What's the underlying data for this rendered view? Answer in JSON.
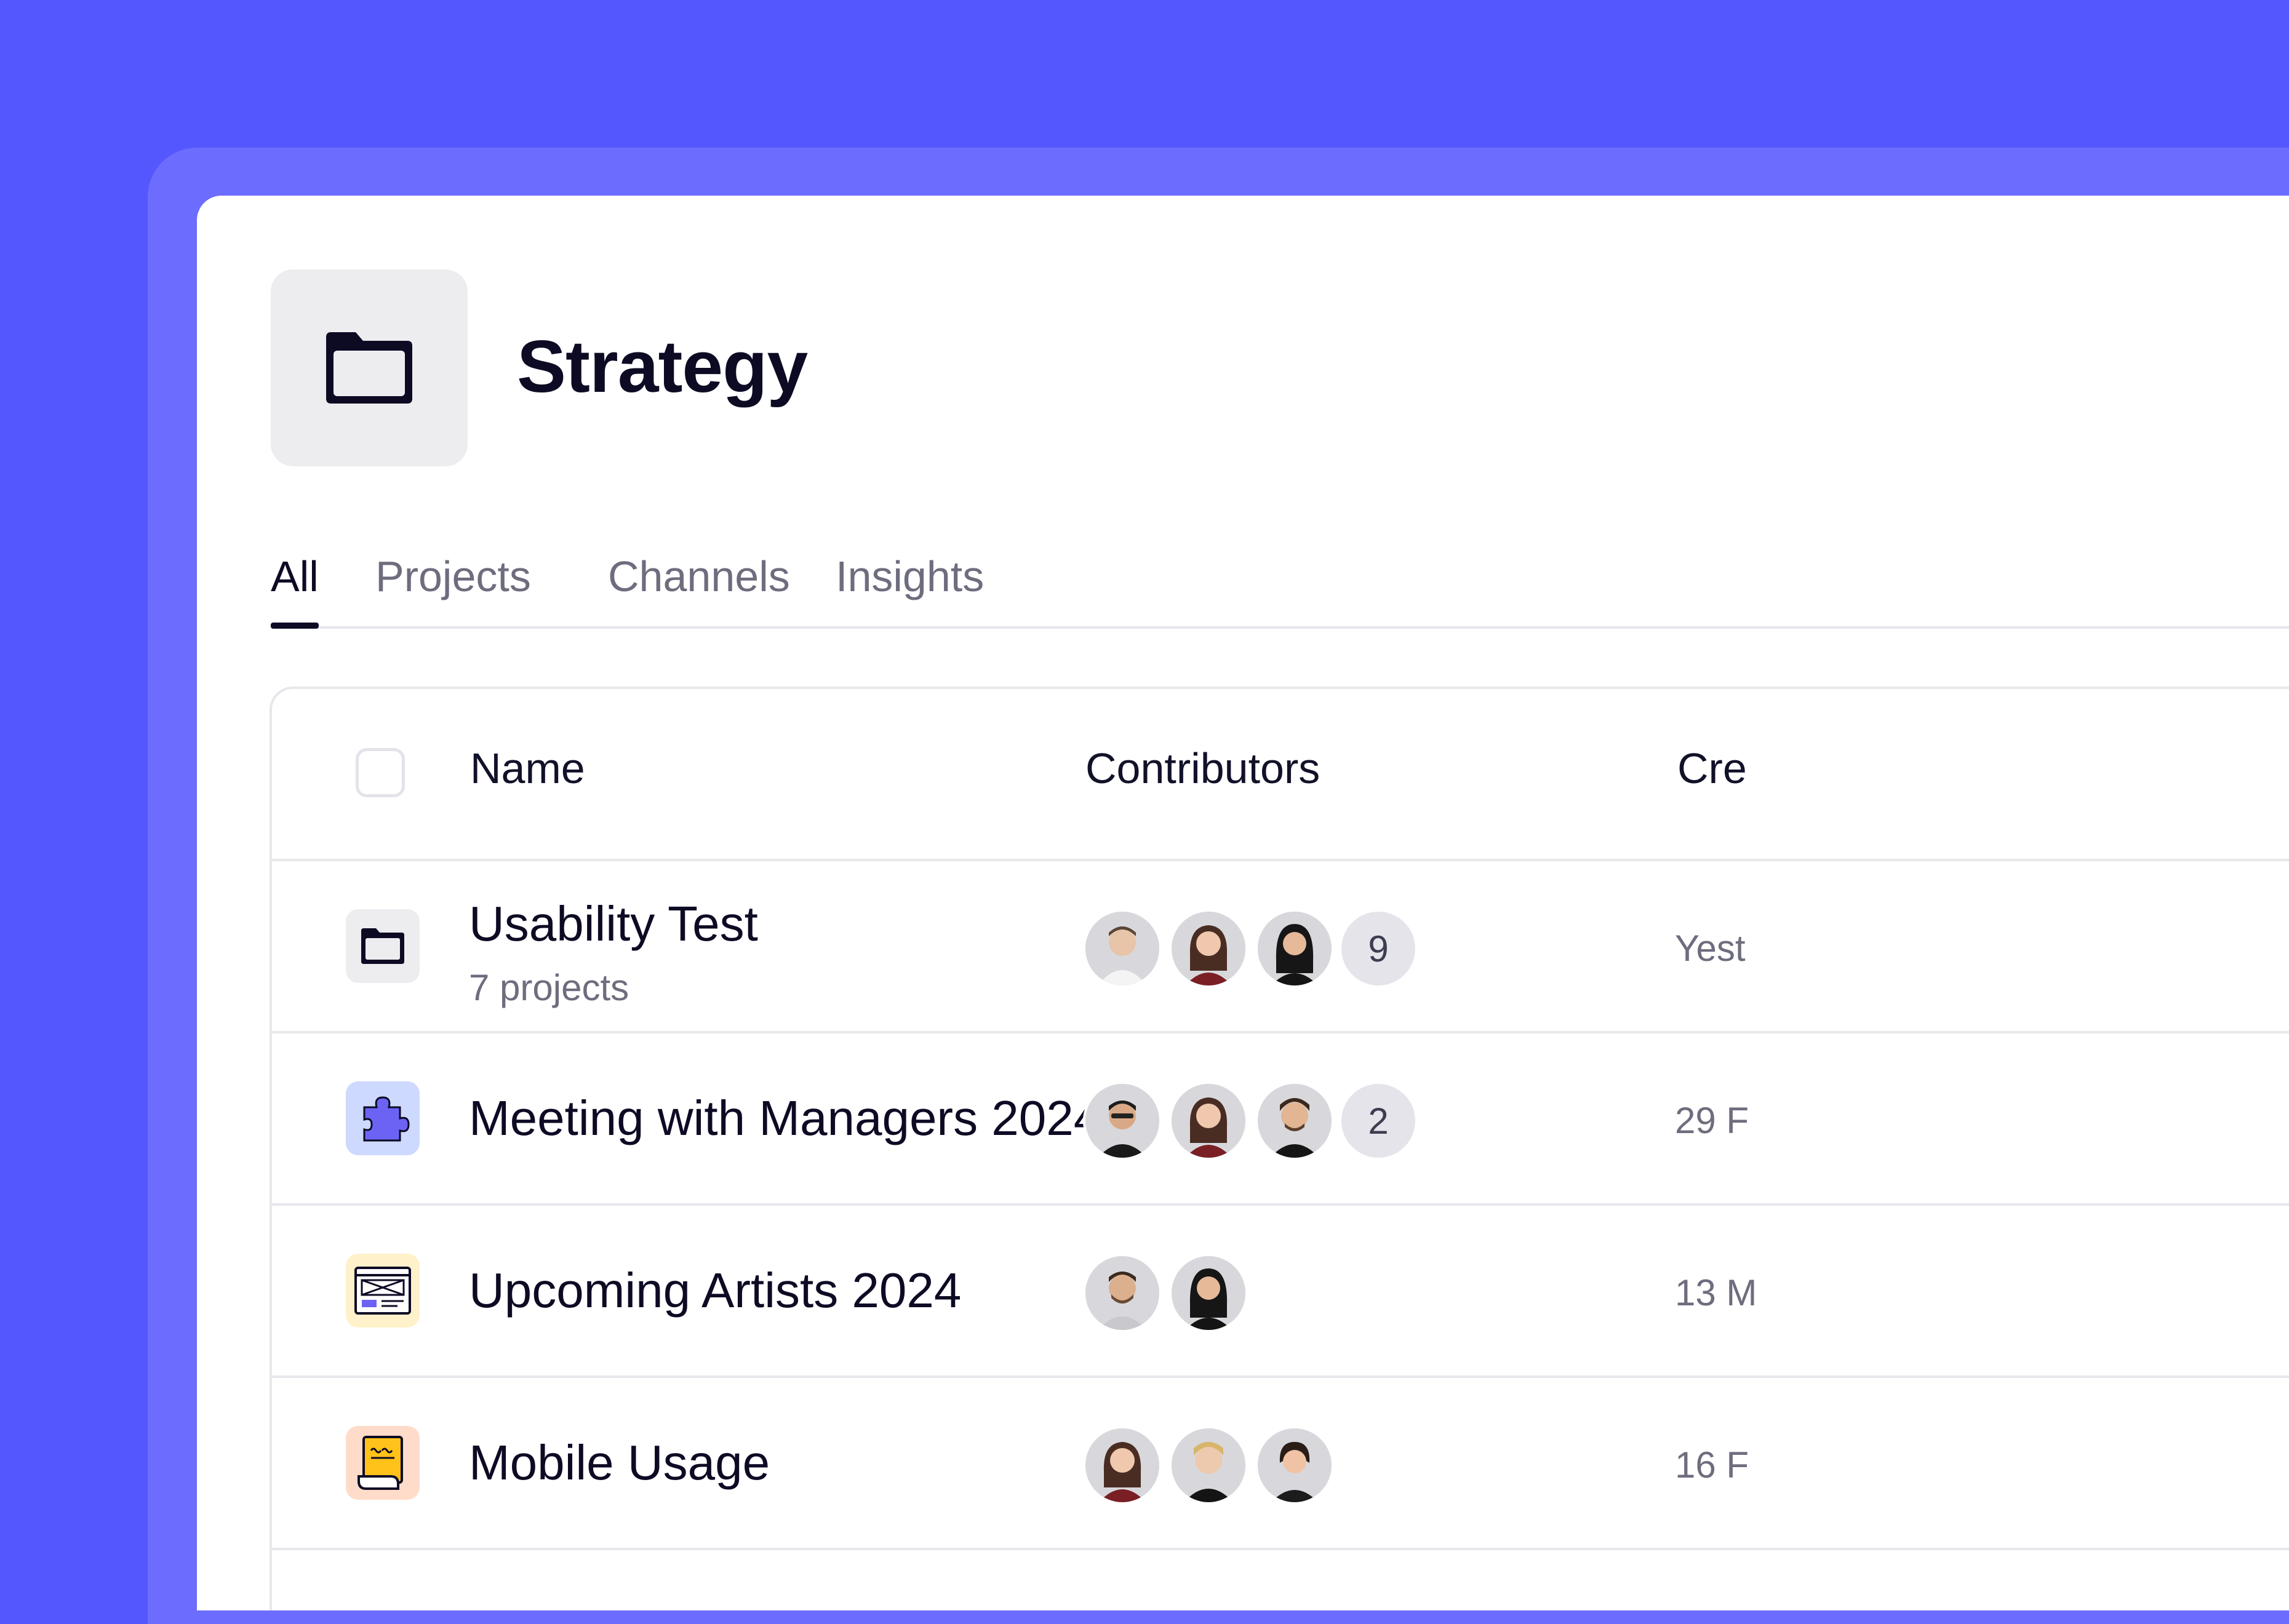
{
  "page": {
    "title": "Strategy",
    "header_icon": "folder-icon"
  },
  "tabs": [
    {
      "label": "All",
      "active": true
    },
    {
      "label": "Projects",
      "active": false
    },
    {
      "label": "Channels",
      "active": false
    },
    {
      "label": "Insights",
      "active": false
    }
  ],
  "table": {
    "columns": {
      "name": "Name",
      "contributors": "Contributors",
      "created": "Cre"
    },
    "rows": [
      {
        "name": "Usability Test",
        "subtitle": "7 projects",
        "icon": "folder-icon",
        "contributors": [
          "avatar-man-smiling",
          "avatar-woman-curly",
          "avatar-woman-dark-hair"
        ],
        "extra_count": "9",
        "created": "Yest"
      },
      {
        "name": "Meeting with Managers 2024",
        "icon": "puzzle-icon",
        "contributors": [
          "avatar-man-glasses",
          "avatar-woman-curly",
          "avatar-man-beard"
        ],
        "extra_count": "2",
        "created": "29 F"
      },
      {
        "name": "Upcoming Artists 2024",
        "icon": "wireframe-icon",
        "contributors": [
          "avatar-man-beard-light",
          "avatar-woman-dark-hair"
        ],
        "created": "13 M"
      },
      {
        "name": "Mobile Usage",
        "icon": "note-icon",
        "contributors": [
          "avatar-woman-curly",
          "avatar-man-blond",
          "avatar-woman-ponytail"
        ],
        "created": "16 F"
      }
    ]
  },
  "colors": {
    "background": "#5557fe",
    "frame": "#6c6cfe",
    "panel": "#ffffff",
    "text_primary": "#0d0b24",
    "text_secondary": "#6d6d7e",
    "puzzle_tile": "#cdd9ff",
    "puzzle": "#6c63f5",
    "wireframe_tile": "#fff1c9",
    "note_tile": "#ffdcc9",
    "note": "#ffc21a"
  }
}
